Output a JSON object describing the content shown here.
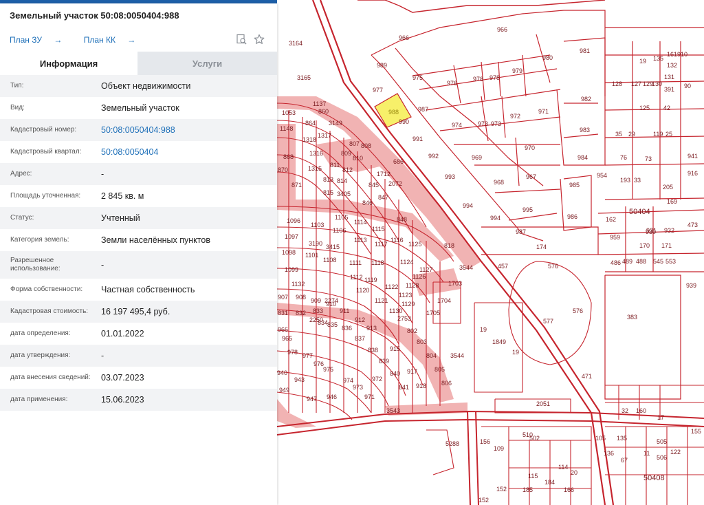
{
  "panel": {
    "title": "Земельный участок 50:08:0050404:988",
    "link_zu": "План ЗУ",
    "link_kk": "План КК",
    "tabs": [
      "Информация",
      "Услуги"
    ],
    "rows": [
      {
        "label": "Тип:",
        "value": "Объект недвижимости",
        "link": false
      },
      {
        "label": "Вид:",
        "value": "Земельный участок",
        "link": false
      },
      {
        "label": "Кадастровый номер:",
        "value": "50:08:0050404:988",
        "link": true
      },
      {
        "label": "Кадастровый квартал:",
        "value": "50:08:0050404",
        "link": true
      },
      {
        "label": "Адрес:",
        "value": "-",
        "link": false
      },
      {
        "label": "Площадь уточненная:",
        "value": "2 845 кв. м",
        "link": false
      },
      {
        "label": "Статус:",
        "value": "Учтенный",
        "link": false
      },
      {
        "label": "Категория земель:",
        "value": "Земли населённых пунктов",
        "link": false
      },
      {
        "label": "Разрешенное использование:",
        "value": "-",
        "link": false
      },
      {
        "label": "Форма собственности:",
        "value": "Частная собственность",
        "link": false
      },
      {
        "label": "Кадастровая стоимость:",
        "value": "16 197 495,4 руб.",
        "link": false
      },
      {
        "label": "дата определения:",
        "value": "01.01.2022",
        "link": false
      },
      {
        "label": "дата утверждения:",
        "value": "-",
        "link": false
      },
      {
        "label": "дата внесения сведений:",
        "value": "03.07.2023",
        "link": false
      },
      {
        "label": "дата применения:",
        "value": "15.06.2023",
        "link": false
      }
    ]
  },
  "colors": {
    "accent": "#1d6fb8",
    "parcel_line": "#c6252e",
    "parcel_fill": "#f1b3b3",
    "selected_parcel": "#f7f06a"
  },
  "map": {
    "selected": "988",
    "labels": [
      "966",
      "3164",
      "966",
      "981",
      "980",
      "989",
      "975",
      "976",
      "978",
      "978",
      "979",
      "977",
      "988",
      "987",
      "982",
      "990",
      "974",
      "973",
      "973",
      "972",
      "971",
      "983",
      "991",
      "992",
      "969",
      "968",
      "970",
      "967",
      "984",
      "993",
      "985",
      "954",
      "994",
      "986",
      "995",
      "994",
      "987",
      "174",
      "3165",
      "1137",
      "1053",
      "860",
      "1148",
      "864",
      "3149",
      "1318",
      "1317",
      "807",
      "808",
      "870",
      "868",
      "1316",
      "809",
      "810",
      "1315",
      "811",
      "812",
      "813",
      "814",
      "871",
      "815",
      "3405",
      "845",
      "846",
      "847",
      "1712",
      "2072",
      "848",
      "1096",
      "1103",
      "1105",
      "1114",
      "1115",
      "1116",
      "1125",
      "1097",
      "1106",
      "1113",
      "1117",
      "1098",
      "3190",
      "3415",
      "1101",
      "1108",
      "1111",
      "1118",
      "1099",
      "1124",
      "1126",
      "1127",
      "1112",
      "1119",
      "1120",
      "1121",
      "1122",
      "1123",
      "1128",
      "1129",
      "1130",
      "1132",
      "907",
      "908",
      "909",
      "2250",
      "2753",
      "2274",
      "831",
      "832",
      "833",
      "834",
      "835",
      "836",
      "837",
      "838",
      "839",
      "840",
      "841",
      "910",
      "911",
      "912",
      "913",
      "915",
      "917",
      "918",
      "966",
      "965",
      "978",
      "977",
      "976",
      "975",
      "974",
      "973",
      "971",
      "972",
      "949",
      "947",
      "946",
      "943",
      "940",
      "802",
      "803",
      "804",
      "805",
      "806",
      "1703",
      "1704",
      "1705",
      "3544",
      "3544",
      "3543",
      "19",
      "1849",
      "19",
      "457",
      "576",
      "576",
      "577",
      "471",
      "2051",
      "383",
      "42",
      "125",
      "129",
      "127",
      "128",
      "130",
      "131",
      "132",
      "90",
      "391",
      "161910",
      "135",
      "19",
      "35",
      "29",
      "119",
      "25",
      "76",
      "73",
      "941",
      "916",
      "193",
      "33",
      "205",
      "169",
      "162",
      "50404",
      "959",
      "930",
      "931",
      "932",
      "170",
      "171",
      "473",
      "486",
      "489",
      "488",
      "545",
      "553",
      "939",
      "155",
      "105",
      "32",
      "160",
      "17",
      "135",
      "136",
      "67",
      "11",
      "505",
      "506",
      "122",
      "50408",
      "152",
      "156",
      "109",
      "510",
      "502",
      "115",
      "114",
      "184",
      "185",
      "166",
      "20",
      "152",
      "818",
      "686",
      "5288"
    ]
  }
}
